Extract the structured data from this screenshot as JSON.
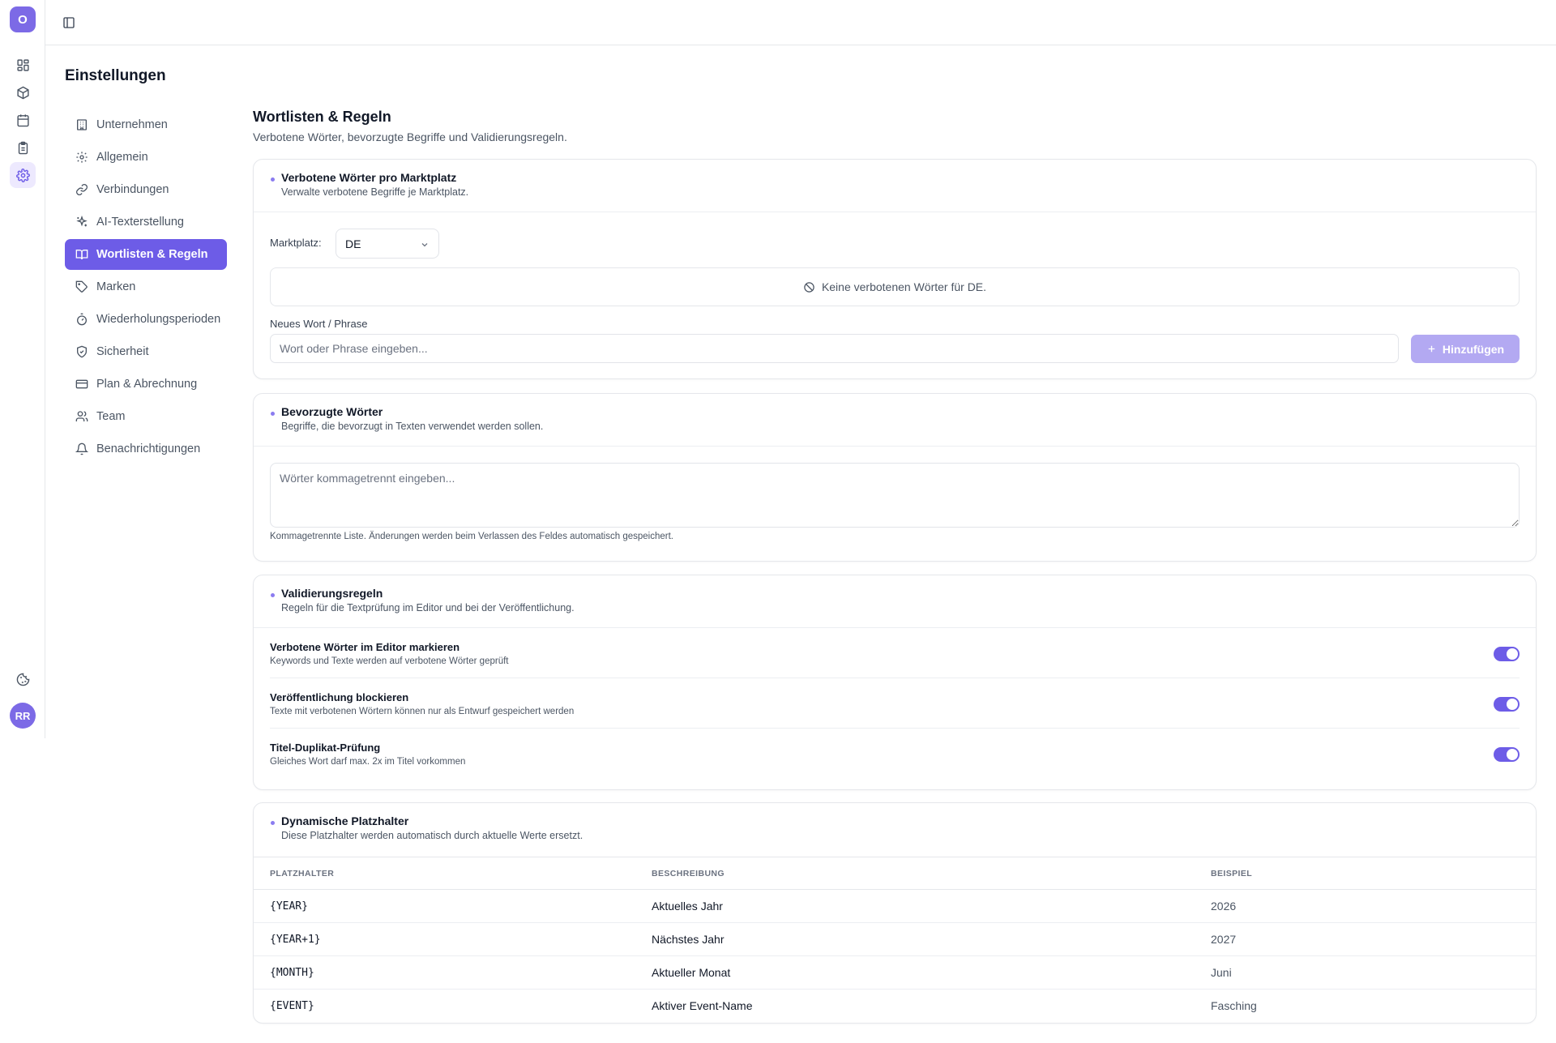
{
  "rail": {
    "logo": "O",
    "avatar": "RR",
    "icons": [
      "dashboard-icon",
      "package-icon",
      "calendar-icon",
      "clipboard-icon",
      "settings-icon",
      "cookie-icon"
    ]
  },
  "page": {
    "title": "Einstellungen"
  },
  "subnav": [
    {
      "label": "Unternehmen",
      "icon": "building-icon"
    },
    {
      "label": "Allgemein",
      "icon": "gear-icon"
    },
    {
      "label": "Verbindungen",
      "icon": "link-icon"
    },
    {
      "label": "AI-Texterstellung",
      "icon": "sparkles-icon"
    },
    {
      "label": "Wortlisten & Regeln",
      "icon": "book-icon",
      "active": true
    },
    {
      "label": "Marken",
      "icon": "tag-icon"
    },
    {
      "label": "Wiederholungsperioden",
      "icon": "timer-icon"
    },
    {
      "label": "Sicherheit",
      "icon": "shield-icon"
    },
    {
      "label": "Plan & Abrechnung",
      "icon": "credit-card-icon"
    },
    {
      "label": "Team",
      "icon": "users-icon"
    },
    {
      "label": "Benachrichtigungen",
      "icon": "bell-icon"
    }
  ],
  "section": {
    "title": "Wortlisten & Regeln",
    "subtitle": "Verbotene Wörter, bevorzugte Begriffe und Validierungsregeln."
  },
  "forbidden": {
    "title": "Verbotene Wörter pro Marktplatz",
    "subtitle": "Verwalte verbotene Begriffe je Marktplatz.",
    "market_label": "Marktplatz:",
    "market_value": "DE",
    "empty_text": "Keine verbotenen Wörter für DE.",
    "new_label": "Neues Wort / Phrase",
    "new_placeholder": "Wort oder Phrase eingeben...",
    "add_label": "Hinzufügen"
  },
  "preferred": {
    "title": "Bevorzugte Wörter",
    "subtitle": "Begriffe, die bevorzugt in Texten verwendet werden sollen.",
    "placeholder": "Wörter kommagetrennt eingeben...",
    "hint": "Kommagetrennte Liste. Änderungen werden beim Verlassen des Feldes automatisch gespeichert."
  },
  "validation": {
    "title": "Validierungsregeln",
    "subtitle": "Regeln für die Textprüfung im Editor und bei der Veröffentlichung.",
    "rules": [
      {
        "title": "Verbotene Wörter im Editor markieren",
        "desc": "Keywords und Texte werden auf verbotene Wörter geprüft",
        "enabled": true
      },
      {
        "title": "Veröffentlichung blockieren",
        "desc": "Texte mit verbotenen Wörtern können nur als Entwurf gespeichert werden",
        "enabled": true
      },
      {
        "title": "Titel-Duplikat-Prüfung",
        "desc": "Gleiches Wort darf max. 2x im Titel vorkommen",
        "enabled": true
      }
    ]
  },
  "placeholders": {
    "title": "Dynamische Platzhalter",
    "subtitle": "Diese Platzhalter werden automatisch durch aktuelle Werte ersetzt.",
    "columns": [
      "PLATZHALTER",
      "BESCHREIBUNG",
      "BEISPIEL"
    ],
    "rows": [
      [
        "{YEAR}",
        "Aktuelles Jahr",
        "2026"
      ],
      [
        "{YEAR+1}",
        "Nächstes Jahr",
        "2027"
      ],
      [
        "{MONTH}",
        "Aktueller Monat",
        "Juni"
      ],
      [
        "{EVENT}",
        "Aktiver Event-Name",
        "Fasching"
      ]
    ]
  },
  "colors": {
    "accent": "#6d5ce7",
    "accent_soft": "#b3a9f2"
  }
}
